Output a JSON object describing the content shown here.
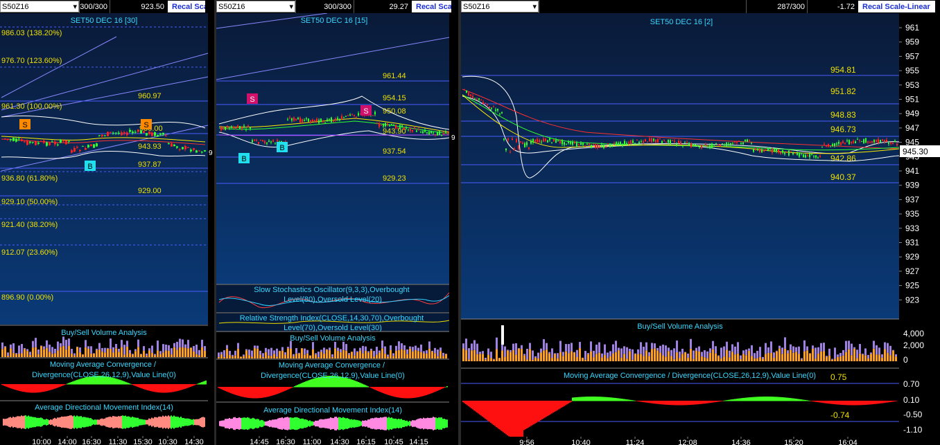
{
  "panes": [
    {
      "symbol": "S50Z16",
      "count": "300/300",
      "value": "923.50",
      "recal": "Recal Scale",
      "title": "SET50 DEC 16  [30]",
      "fib_labels": [
        "986.03 (138.20%)",
        "976.70 (123.60%)",
        "961.30 (100.00%)",
        "936.80 (61.80%)",
        "929.10 (50.00%)",
        "921.40 (38.20%)",
        "912.07 (23.60%)",
        "896.90 (0.00%)"
      ],
      "levels": [
        "960.97",
        "950.00",
        "943.93",
        "937.87",
        "929.00"
      ],
      "markers": [
        "S",
        "S",
        "B"
      ],
      "indicators": [
        "Buy/Sell Volume Analysis",
        "Moving Average Convergence / Divergence(CLOSE,26,12,9),Value Line(0)",
        "Average Directional Movement Index(14)"
      ],
      "time_labels": [
        "10:00",
        "14:00",
        "16:30",
        "11:30",
        "15:30",
        "10:30",
        "14:30"
      ],
      "edge_value": "9"
    },
    {
      "symbol": "S50Z16",
      "count": "300/300",
      "value": "29.27",
      "recal": "Recal Scale",
      "title": "SET50 DEC 16  [15]",
      "levels": [
        "961.44",
        "954.15",
        "950.08",
        "943.90",
        "937.54",
        "929.23"
      ],
      "markers": [
        "S",
        "S",
        "B",
        "B"
      ],
      "indicators": [
        "Slow Stochastics Oscillator(9,3,3),Overbought Level(80),Oversold Level(20)",
        "Relative Strength Index(CLOSE,14,30,70),Overbought Level(70),Oversold Level(30)",
        "Buy/Sell Volume Analysis",
        "Moving Average Convergence / Divergence(CLOSE,26,12,9),Value Line(0)",
        "Average Directional Movement Index(14)"
      ],
      "time_labels": [
        "14:45",
        "16:30",
        "11:00",
        "14:30",
        "16:15",
        "10:45",
        "14:15"
      ],
      "edge_value": "9"
    },
    {
      "symbol": "S50Z16",
      "count": "287/300",
      "value": "-1.72",
      "recal": "Recal Scale-Linear",
      "title": "SET50 DEC 16  [2]",
      "levels": [
        "954.81",
        "951.82",
        "948.83",
        "946.73",
        "942.86",
        "940.37"
      ],
      "price_axis": [
        "961",
        "959",
        "957",
        "955",
        "953",
        "951",
        "949",
        "947",
        "945",
        "943",
        "941",
        "939",
        "937",
        "935",
        "933",
        "931",
        "929",
        "927",
        "925",
        "923"
      ],
      "current_price": "945.30",
      "volume_title": "Buy/Sell Volume Analysis",
      "volume_axis": [
        "4,000",
        "2,000",
        "0"
      ],
      "macd_title": "Moving Average Convergence / Divergence(CLOSE,26,12,9),Value Line(0)",
      "macd_levels": [
        "0.75",
        "-0.74"
      ],
      "macd_axis": [
        "0.70",
        "0.10",
        "-0.50",
        "-1.10"
      ],
      "time_labels": [
        "9:56",
        "10:40",
        "11:24",
        "12:08",
        "14:36",
        "15:20",
        "16:04"
      ]
    }
  ],
  "colors": {
    "bg_top": "#0a1a38",
    "bg_bottom": "#0a3a78",
    "grid_line": "#4a5cff",
    "level_text": "#f0e000",
    "title_text": "#38d8ff",
    "buy_marker": "#20e0f0",
    "sell_marker": "#ff8a00",
    "sell_marker_alt": "#d0106a",
    "vol_buy": "#ffa020",
    "vol_sell": "#a080e0",
    "macd_pos": "#40ff20",
    "macd_neg": "#ff1010"
  }
}
